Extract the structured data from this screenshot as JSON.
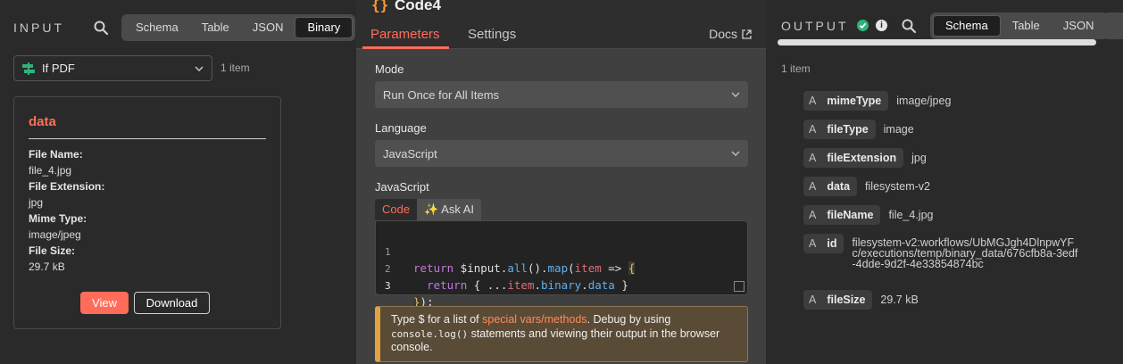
{
  "input": {
    "title": "INPUT",
    "view_tabs": [
      "Schema",
      "Table",
      "JSON",
      "Binary"
    ],
    "active_view": "Binary",
    "source_node": "If PDF",
    "item_count": "1 item",
    "binary": {
      "title": "data",
      "file_name_label": "File Name:",
      "file_name": "file_4.jpg",
      "file_ext_label": "File Extension:",
      "file_ext": "jpg",
      "mime_label": "Mime Type:",
      "mime": "image/jpeg",
      "size_label": "File Size:",
      "size": "29.7 kB",
      "view_label": "View",
      "download_label": "Download"
    }
  },
  "node": {
    "icon": "{}",
    "name": "Code4",
    "tabs": [
      "Parameters",
      "Settings"
    ],
    "active_tab": "Parameters",
    "docs_label": "Docs",
    "mode_label": "Mode",
    "mode_value": "Run Once for All Items",
    "language_label": "Language",
    "language_value": "JavaScript",
    "code_label": "JavaScript",
    "code_tabs": {
      "code": "Code",
      "ask_ai": "✨ Ask AI"
    },
    "code_lines": [
      "1",
      "2",
      "3"
    ],
    "hint": {
      "pre": "Type $ for a list of ",
      "link": "special vars/methods",
      "post1": ". Debug by using ",
      "code": "console.log()",
      "post2": " statements and viewing their output in the browser console."
    }
  },
  "output": {
    "title": "OUTPUT",
    "view_tabs": [
      "Schema",
      "Table",
      "JSON"
    ],
    "active_view": "Schema",
    "item_count": "1 item",
    "fields": [
      {
        "key": "mimeType",
        "value": "image/jpeg"
      },
      {
        "key": "fileType",
        "value": "image"
      },
      {
        "key": "fileExtension",
        "value": "jpg"
      },
      {
        "key": "data",
        "value": "filesystem-v2"
      },
      {
        "key": "fileName",
        "value": "file_4.jpg"
      },
      {
        "key": "id",
        "value": "filesystem-v2:workflows/UbMGJgh4DlnpwYFc/executions/temp/binary_data/676cfb8a-3edf-4dde-9d2f-4e33854874bc"
      },
      {
        "key": "fileSize",
        "value": "29.7 kB"
      }
    ],
    "type_glyph": "A"
  },
  "colors": {
    "accent": "#ff6d5a",
    "success": "#2fb27a",
    "warning": "#e2a33c"
  }
}
